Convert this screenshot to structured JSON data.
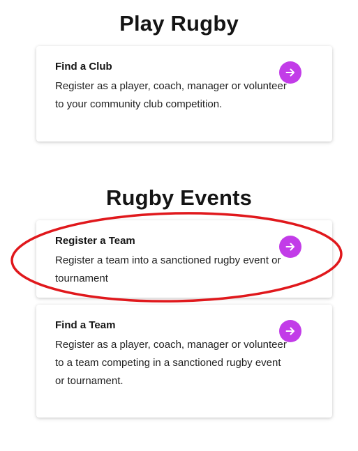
{
  "sections": [
    {
      "title": "Play Rugby",
      "cards": [
        {
          "title": "Find a Club",
          "description": "Register as a player, coach, manager or volunteer to your community club competition."
        }
      ]
    },
    {
      "title": "Rugby Events",
      "cards": [
        {
          "title": "Register a Team",
          "description": "Register a team into a sanctioned rugby event or tournament"
        },
        {
          "title": "Find a Team",
          "description": "Register as a player, coach, manager or volunteer to a team competing in a sanctioned rugby event or tournament."
        }
      ]
    }
  ],
  "icons": {
    "card_action": "arrow-right-icon"
  },
  "colors": {
    "accent": "#c23ce8",
    "annotation": "#e0181c"
  }
}
